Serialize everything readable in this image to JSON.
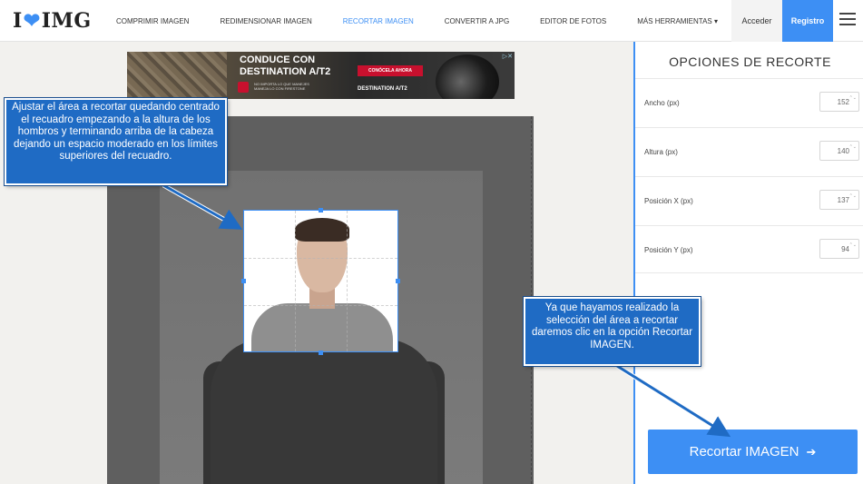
{
  "header": {
    "logo_left": "I",
    "logo_heart": "❤",
    "logo_right": "IMG",
    "nav": [
      {
        "label": "COMPRIMIR IMAGEN",
        "active": false
      },
      {
        "label": "REDIMENSIONAR IMAGEN",
        "active": false
      },
      {
        "label": "RECORTAR IMAGEN",
        "active": true
      },
      {
        "label": "CONVERTIR A JPG",
        "active": false
      },
      {
        "label": "EDITOR DE FOTOS",
        "active": false
      },
      {
        "label": "MÁS HERRAMIENTAS ▾",
        "active": false
      }
    ],
    "login": "Acceder",
    "register": "Registro",
    "menu_icon": "hamburger-icon"
  },
  "ad": {
    "line1": "CONDUCE CON",
    "line2": "DESTINATION A/T2",
    "cta": "CONÓCELA AHORA",
    "fine_print": "NO IMPORTA LO QUE MANEJES MANEJA LO CON FIRESTONE",
    "product": "DESTINATION A/T2",
    "ad_marker": "▷✕"
  },
  "panel": {
    "title": "OPCIONES DE RECORTE",
    "fields": [
      {
        "label": "Ancho (px)",
        "value": "152"
      },
      {
        "label": "Altura (px)",
        "value": "140"
      },
      {
        "label": "Posición X (px)",
        "value": "137"
      },
      {
        "label": "Posición Y (px)",
        "value": "94"
      }
    ],
    "spinner": "⌃⌄",
    "crop_button": "Recortar IMAGEN",
    "crop_button_icon": "➔"
  },
  "callouts": {
    "left": "Ajustar el área a recortar quedando centrado el recuadro empezando a la altura de los hombros y terminando arriba de la cabeza dejando un espacio moderado en los límites superiores del recuadro.",
    "right": "Ya que hayamos realizado la selección del área a recortar daremos clic en la opción Recortar IMAGEN."
  },
  "colors": {
    "accent": "#3d8ff4",
    "callout_bg": "#1f6bc4"
  }
}
